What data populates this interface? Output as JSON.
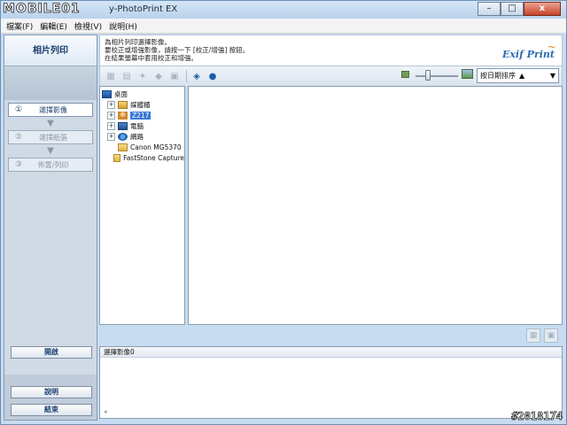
{
  "window": {
    "title": "y-PhotoPrint EX",
    "watermark_top": "MOBILE01",
    "watermark_bottom": "#2018174",
    "controls": {
      "minimize": "–",
      "maximize": "□",
      "close": "x"
    }
  },
  "menu": [
    "檔案(F)",
    "編輯(E)",
    "檢視(V)",
    "說明(H)"
  ],
  "left": {
    "title": "相片列印",
    "steps": [
      {
        "num": "①",
        "label": "選擇影像",
        "active": true
      },
      {
        "num": "②",
        "label": "選擇紙張",
        "active": false
      },
      {
        "num": "③",
        "label": "佈置/列印",
        "active": false
      }
    ],
    "open_button": "開啟",
    "help_button": "說明",
    "exit_button": "結束"
  },
  "info": {
    "lines": [
      "為相片列印選擇影像。",
      "要校正或增強影像，請按一下 [校正/增強] 按鈕。",
      "在結果螢幕中套用校正和增強。"
    ],
    "logo": "Exif Print"
  },
  "toolbar": {
    "icons": [
      "grid-icon",
      "select-icon",
      "correct-icon",
      "enhance-icon",
      "print-icon",
      "scan-icon",
      "web-icon"
    ],
    "sort": {
      "label": "按日期排序",
      "direction": "▲"
    }
  },
  "tree": [
    {
      "label": "桌面",
      "icon": "desktop",
      "expander": "",
      "level": 0,
      "selected": false
    },
    {
      "label": "媒體櫃",
      "icon": "library",
      "expander": "+",
      "level": 1,
      "selected": false
    },
    {
      "label": "Z217",
      "icon": "user",
      "expander": "+",
      "level": 1,
      "selected": true
    },
    {
      "label": "電腦",
      "icon": "pc",
      "expander": "+",
      "level": 1,
      "selected": false
    },
    {
      "label": "網路",
      "icon": "net",
      "expander": "+",
      "level": 1,
      "selected": false
    },
    {
      "label": "Canon MG5370",
      "icon": "folder",
      "expander": "",
      "level": 1,
      "selected": false
    },
    {
      "label": "FastStone Capture",
      "icon": "folder",
      "expander": "",
      "level": 1,
      "selected": false
    }
  ],
  "selected": {
    "header": "選擇影像0",
    "scroll_left": "◂",
    "scroll_right": "▸"
  }
}
